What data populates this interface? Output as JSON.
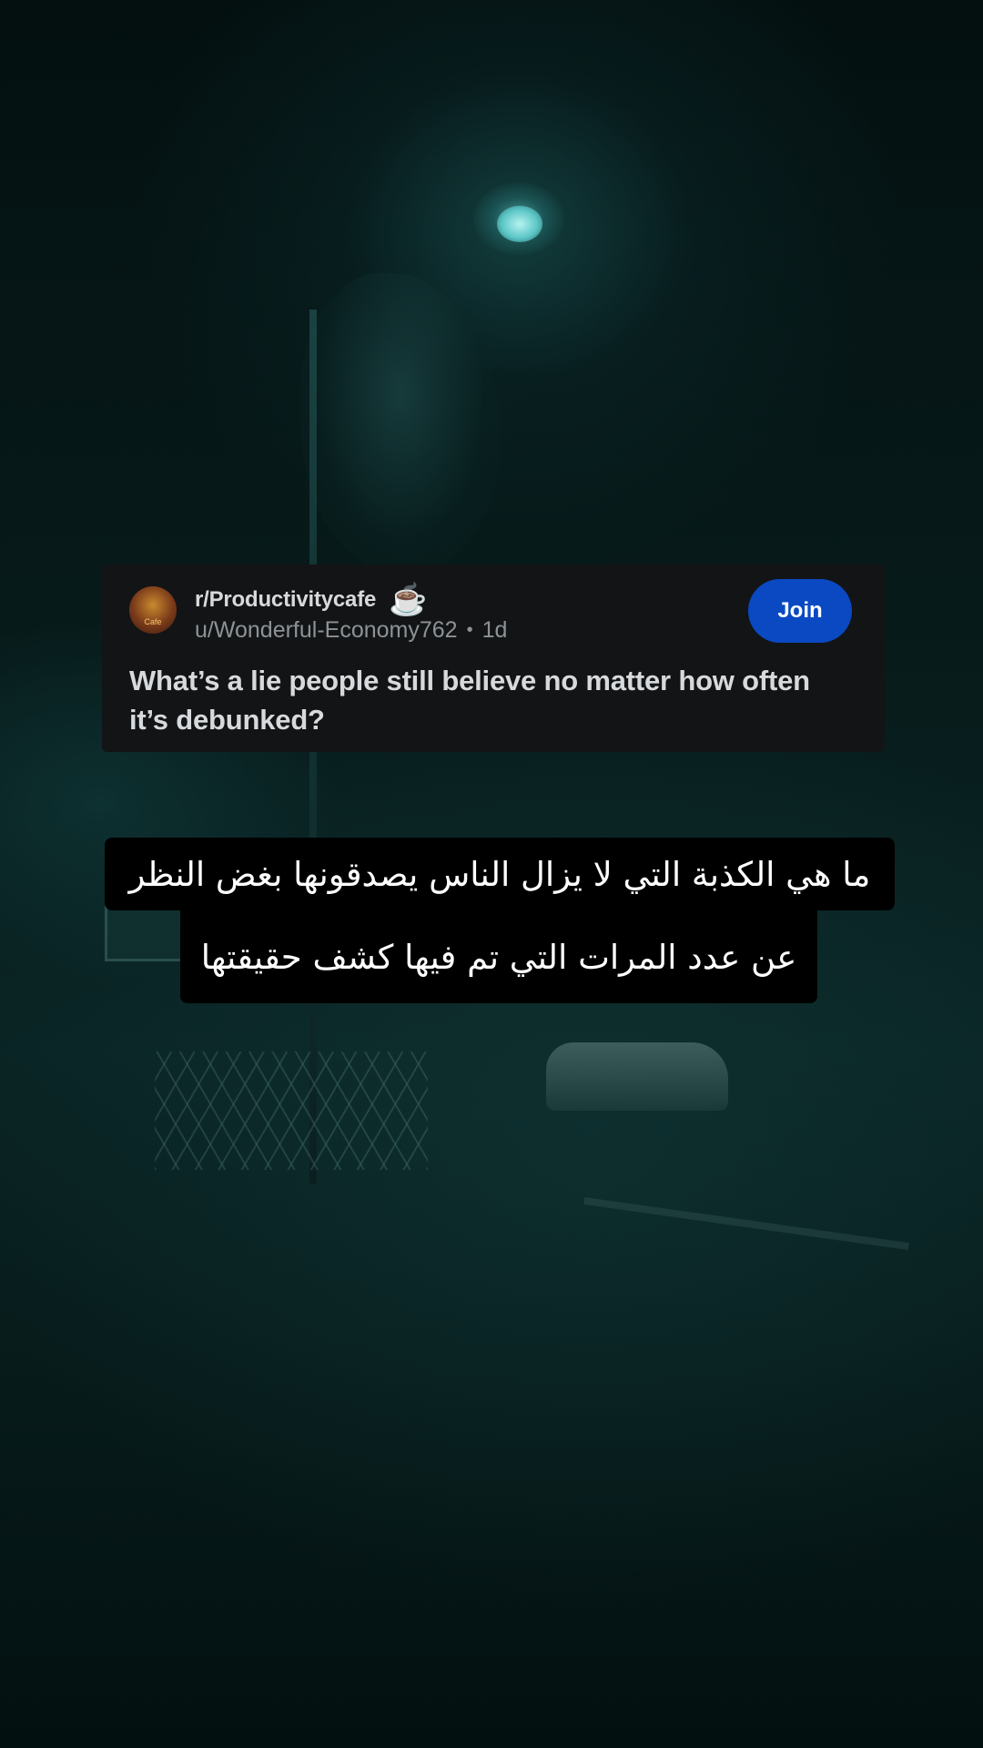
{
  "post": {
    "subreddit": "r/Productivitycafe",
    "subreddit_icon": "coffee-cup-icon",
    "avatar_text": "Cafe",
    "author": "u/Wonderful-Economy762",
    "separator": "•",
    "age": "1d",
    "join_label": "Join",
    "title": "What’s a lie people still believe no matter how often it’s debunked?"
  },
  "caption": {
    "line1": "ما هي الكذبة التي لا يزال الناس يصدقونها بغض النظر",
    "line2": "عن عدد المرات التي تم فيها كشف حقيقتها"
  },
  "colors": {
    "join_button": "#0a49c2",
    "card_background": "#131416",
    "caption_background": "#000000"
  }
}
